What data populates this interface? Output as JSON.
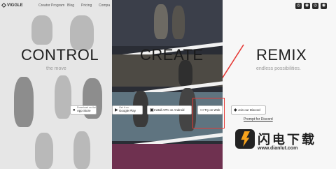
{
  "header": {
    "logo": "VIGGLE",
    "nav": [
      "Creator Program",
      "Blog",
      "Pricing",
      "Compa"
    ]
  },
  "sections": [
    {
      "title": "CONTROL",
      "subtitle": "the move"
    },
    {
      "title": "CREATE",
      "subtitle": ""
    },
    {
      "title": "REMIX",
      "subtitle": "endless possibilities."
    }
  ],
  "buttons": {
    "app_store_small": "Download on the",
    "app_store": "App Store",
    "google_play_small": "Get it on",
    "google_play": "Google Play",
    "apk": "Install APK on Android",
    "web": "Try on Web",
    "discord": "Join our Discord"
  },
  "links": {
    "prompt_discord": "Prompt for Discord"
  },
  "watermark": {
    "title": "闪电下载",
    "url": "www.dianlut.com"
  },
  "colors": {
    "highlight": "#e53935",
    "watermark_accent": "#f7a31c"
  }
}
